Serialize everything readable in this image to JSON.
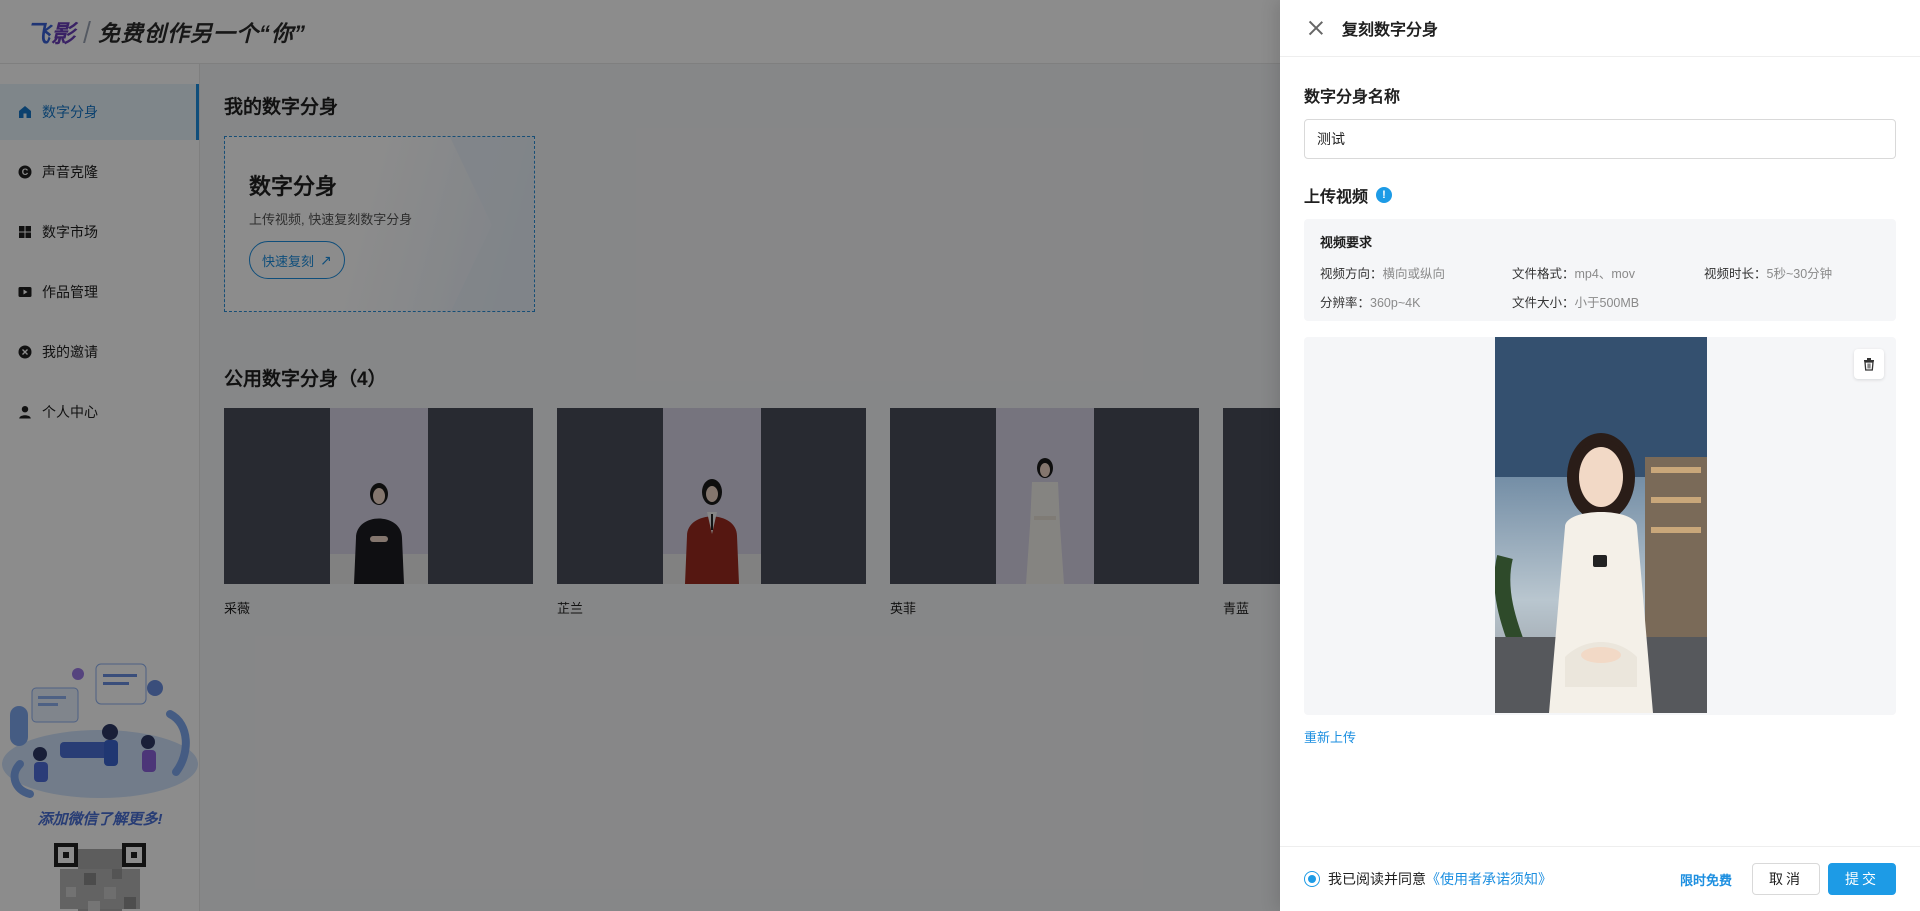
{
  "header": {
    "logo_part1": "飞",
    "logo_part2": "影",
    "slogan": "免费创作另一个“你”"
  },
  "sidebar": {
    "items": [
      {
        "label": "数字分身",
        "icon": "home-icon",
        "active": true
      },
      {
        "label": "声音克隆",
        "icon": "voice-clone-icon",
        "active": false
      },
      {
        "label": "数字市场",
        "icon": "grid-icon",
        "active": false
      },
      {
        "label": "作品管理",
        "icon": "video-icon",
        "active": false
      },
      {
        "label": "我的邀请",
        "icon": "invite-icon",
        "active": false
      },
      {
        "label": "个人中心",
        "icon": "user-icon",
        "active": false
      }
    ],
    "promo_text": "添加微信了解更多!"
  },
  "main": {
    "my_title": "我的数字分身",
    "clone_card": {
      "title": "数字分身",
      "subtitle": "上传视频, 快速复刻数字分身",
      "button": "快速复刻"
    },
    "public_title": "公用数字分身（4）",
    "avatars": [
      {
        "name": "采薇"
      },
      {
        "name": "芷兰"
      },
      {
        "name": "英菲"
      },
      {
        "name": "青蓝"
      }
    ]
  },
  "drawer": {
    "title": "复刻数字分身",
    "name_label": "数字分身名称",
    "name_value": "测试",
    "upload_label": "上传视频",
    "requirements": {
      "title": "视频要求",
      "items": [
        {
          "key": "视频方向：",
          "value": "横向或纵向"
        },
        {
          "key": "文件格式：",
          "value": "mp4、mov"
        },
        {
          "key": "视频时长：",
          "value": "5秒~30分钟"
        },
        {
          "key": "分辨率：",
          "value": "360p~4K"
        },
        {
          "key": "文件大小：",
          "value": "小于500MB"
        }
      ]
    },
    "reupload": "重新上传",
    "footer": {
      "agree_text": "我已阅读并同意",
      "agree_link": "《使用者承诺须知》",
      "limited_free": "限时免费",
      "cancel": "取消",
      "submit": "提交"
    }
  },
  "colors": {
    "accent": "#1d9be6",
    "link": "#1d8fe0",
    "overlay": "rgba(0,0,0,0.45)"
  }
}
